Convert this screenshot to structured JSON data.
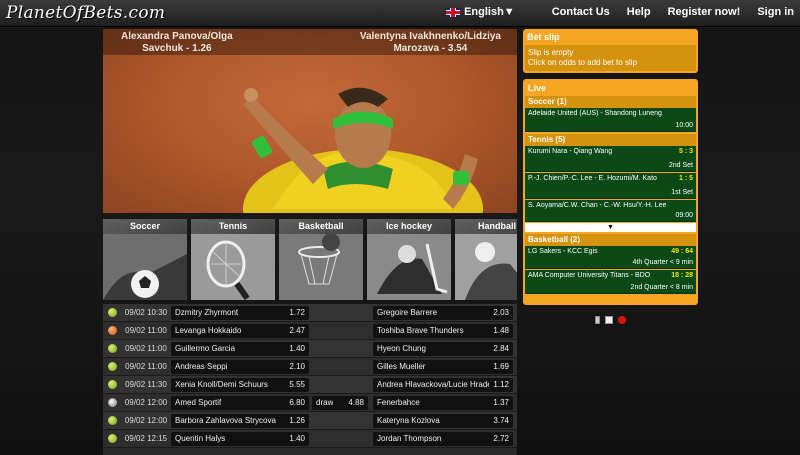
{
  "header": {
    "logo": "PlanetOfBets.com",
    "language": "English",
    "language_arrow": "▼",
    "links": [
      "Contact Us",
      "Help",
      "Register now!",
      "Sign in"
    ]
  },
  "hero": {
    "left_line1": "Alexandra Panova/Olga",
    "left_line2": "Savchuk - 1.26",
    "right_line1": "Valentyna Ivakhnenko/Lidziya",
    "right_line2": "Marozava - 3.54"
  },
  "sports": [
    "Soccer",
    "Tennis",
    "Basketball",
    "Ice hockey",
    "Handball"
  ],
  "events": [
    {
      "status": "tennis",
      "date": "09/02 10:30",
      "home": "Dzmitry Zhyrmont",
      "home_odds": "1.72",
      "away": "Gregoire Barrere",
      "away_odds": "2.03"
    },
    {
      "status": "basketball",
      "date": "09/02 11:00",
      "home": "Levanga Hokkaido",
      "home_odds": "2.47",
      "away": "Toshiba Brave Thunders",
      "away_odds": "1.48"
    },
    {
      "status": "tennis",
      "date": "09/02 11:00",
      "home": "Guillermo Garcia",
      "home_odds": "1.40",
      "away": "Hyeon Chung",
      "away_odds": "2.84"
    },
    {
      "status": "tennis",
      "date": "09/02 11:00",
      "home": "Andreas Seppi",
      "home_odds": "2.10",
      "away": "Gilles Mueller",
      "away_odds": "1.69"
    },
    {
      "status": "tennis",
      "date": "09/02 11:30",
      "home": "Xenia Knoll/Demi Schuurs",
      "home_odds": "5.55",
      "away": "Andrea Hlavackova/Lucie Hradecka",
      "away_odds": "1.12"
    },
    {
      "status": "soccer",
      "date": "09/02 12:00",
      "home": "Amed Sportif",
      "home_odds": "6.80",
      "draw": "draw",
      "draw_odds": "4.88",
      "away": "Fenerbahce",
      "away_odds": "1.37"
    },
    {
      "status": "tennis",
      "date": "09/02 12:00",
      "home": "Barbora Zahlavova Strycova",
      "home_odds": "1.26",
      "away": "Kateryna Kozlova",
      "away_odds": "3.74"
    },
    {
      "status": "tennis",
      "date": "09/02 12:15",
      "home": "Quentin Halys",
      "home_odds": "1.40",
      "away": "Jordan Thompson",
      "away_odds": "2.72"
    }
  ],
  "betslip": {
    "title": "Bet slip",
    "empty": "Slip is empty",
    "hint": "Click on odds to add bet to slip"
  },
  "live": {
    "title": "Live",
    "soccer_group": "Soccer (1)",
    "soccer": [
      {
        "name": "Adelaide United (AUS) - Shandong Luneng",
        "score": "",
        "time": "10:00"
      }
    ],
    "tennis_group": "Tennis (5)",
    "tennis": [
      {
        "name": "Kurumi Nara - Qiang Wang",
        "score": "5 : 3",
        "time": "2nd Set"
      },
      {
        "name": "P.-J. Chien/P.-C. Lee - E. Hozumi/M. Kato",
        "score": "1 : 5",
        "time": "1st Set"
      },
      {
        "name": "S. Aoyama/C.W. Chan - C.-W. Hsu/Y.-H. Lee",
        "score": "",
        "time": "09:00"
      }
    ],
    "more_arrow": "▼",
    "basketball_group": "Basketball (2)",
    "basketball": [
      {
        "name": "LG Sakers - KCC Egis",
        "score": "49 : 64",
        "time": "4th Quarter  < 9 min"
      },
      {
        "name": "AMA Computer University Titans - BDO",
        "score": "18 : 28",
        "time": "2nd Quarter  < 8 min"
      }
    ]
  }
}
